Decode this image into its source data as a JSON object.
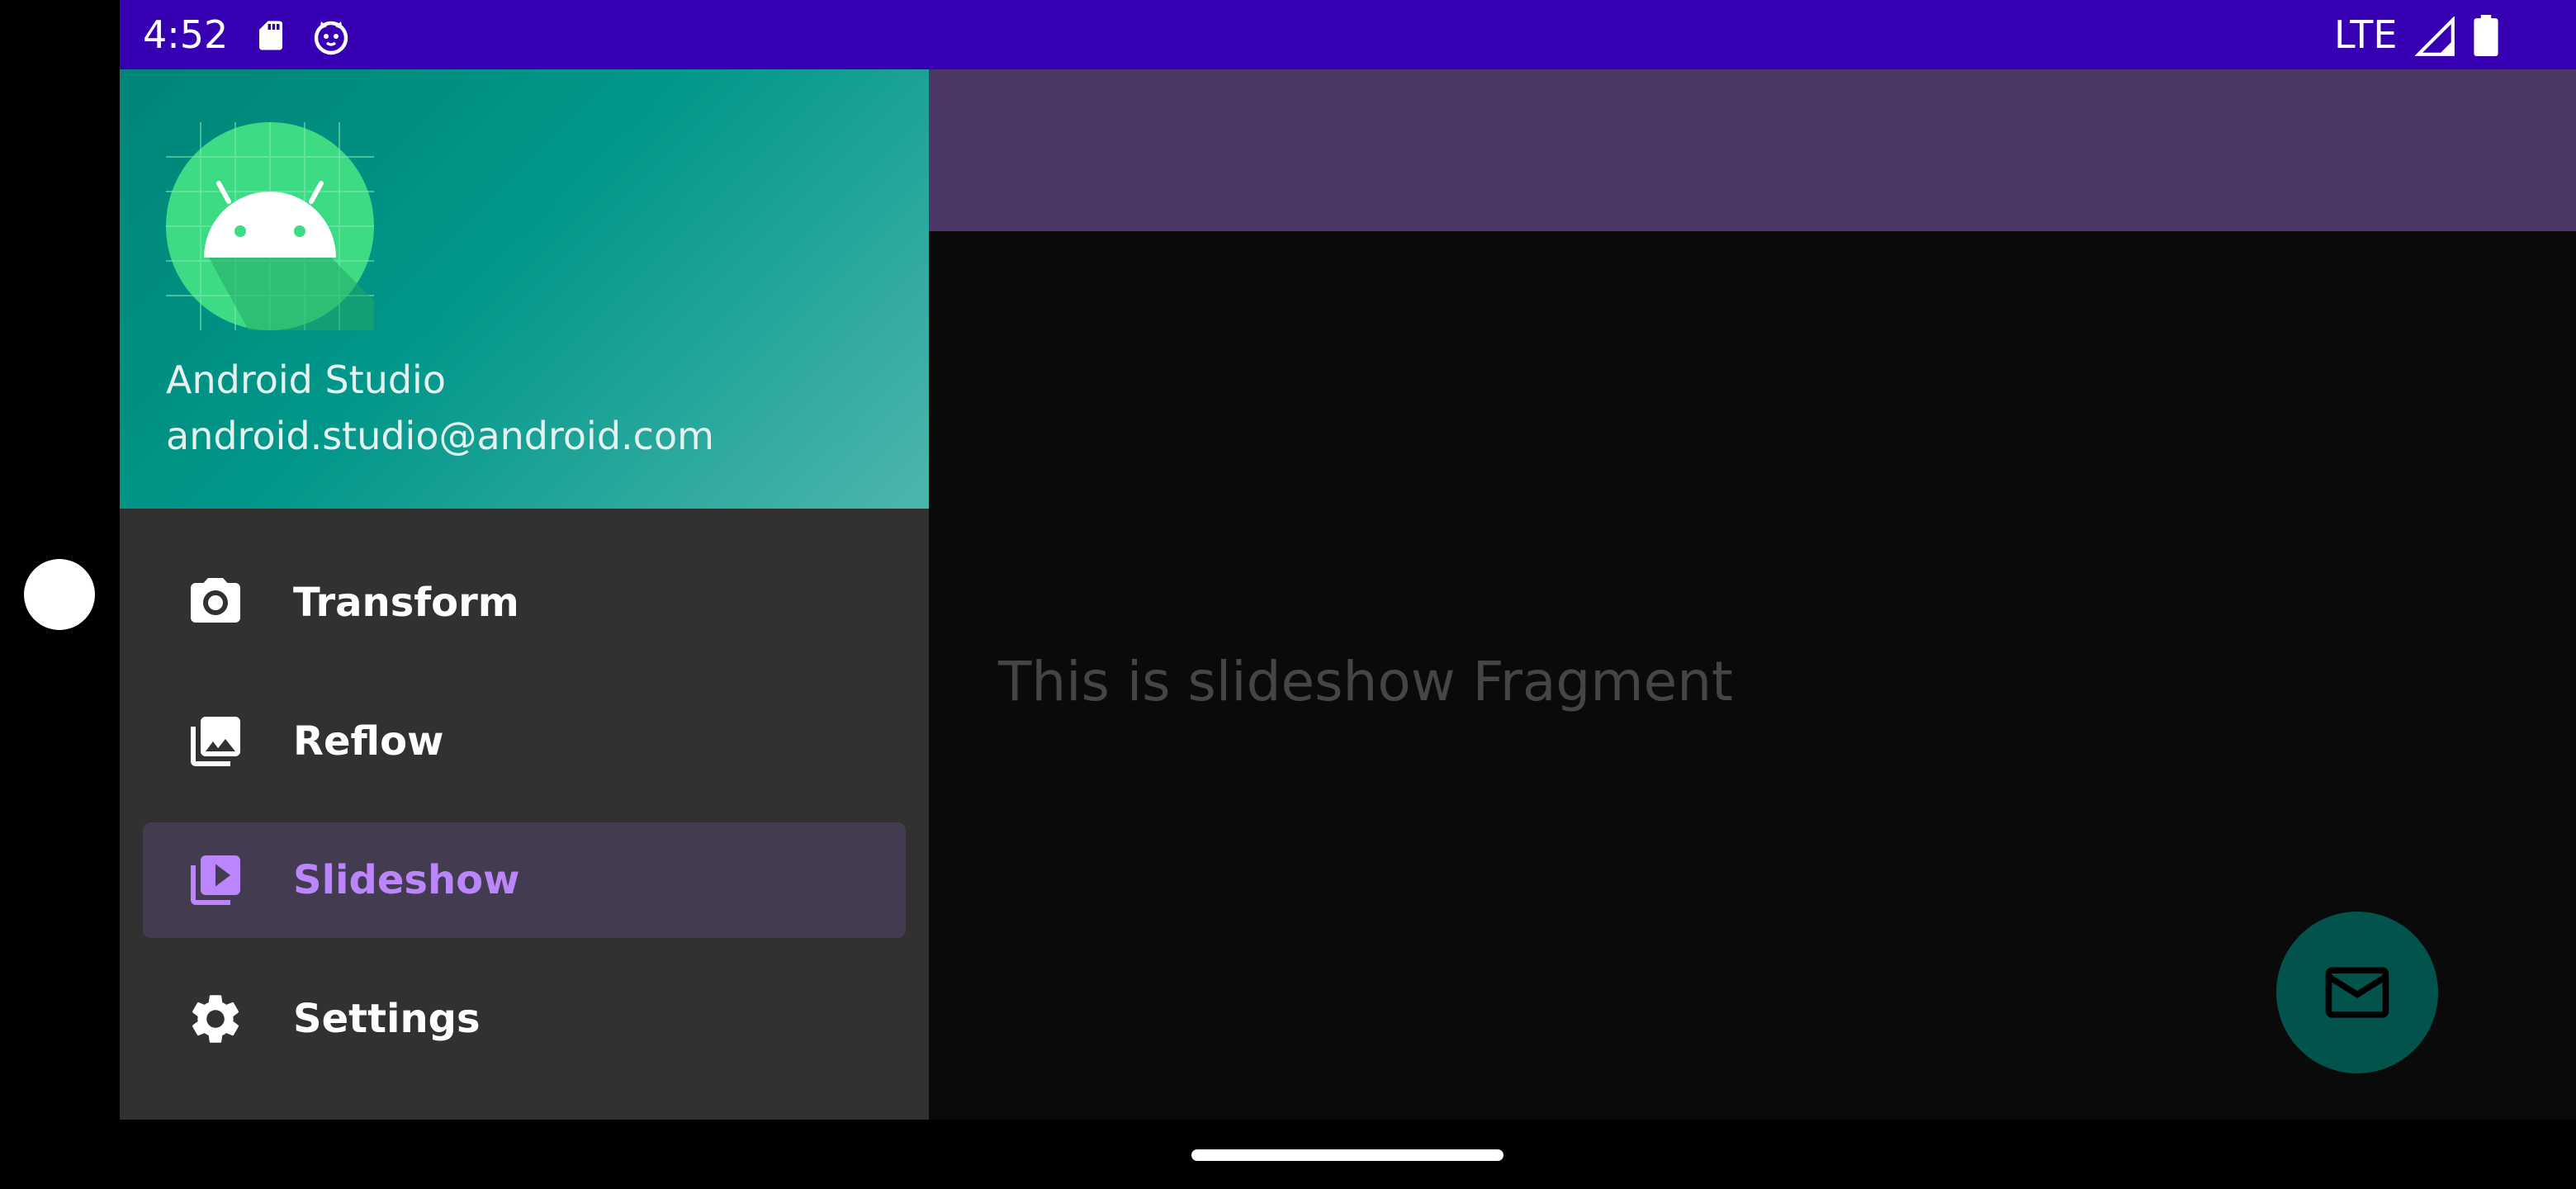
{
  "status_bar": {
    "time": "4:52",
    "network": "LTE",
    "icons": [
      "sd-card-icon",
      "cat-icon",
      "signal-icon",
      "battery-icon"
    ]
  },
  "drawer": {
    "header": {
      "name": "Android Studio",
      "email": "android.studio@android.com",
      "avatar_icon": "android-logo-icon"
    },
    "items": [
      {
        "label": "Transform",
        "icon": "camera-icon",
        "selected": false
      },
      {
        "label": "Reflow",
        "icon": "image-gallery-icon",
        "selected": false
      },
      {
        "label": "Slideshow",
        "icon": "slideshow-icon",
        "selected": true
      },
      {
        "label": "Settings",
        "icon": "gear-icon",
        "selected": false
      }
    ]
  },
  "main": {
    "fragment_text": "This is slideshow Fragment",
    "fab_icon": "email-icon"
  },
  "colors": {
    "status_bar": "#3700b3",
    "app_bar": "#4d3766",
    "drawer_bg": "#313131",
    "selected_item_bg": "#433b4f",
    "accent": "#bb86fc",
    "fab": "#03534d"
  }
}
